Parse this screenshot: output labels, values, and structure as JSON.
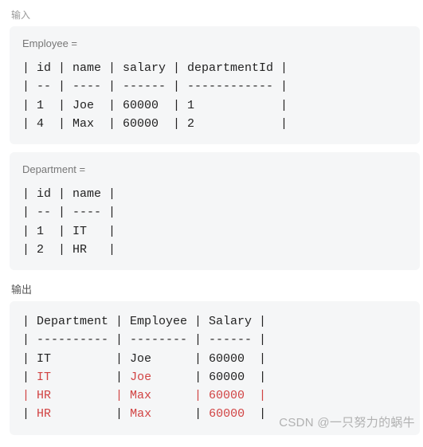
{
  "header_small": "输入",
  "block1": {
    "label": "Employee =",
    "lines": [
      "| id | name | salary | departmentId |",
      "| -- | ---- | ------ | ------------ |",
      "| 1  | Joe  | 60000  | 1            |",
      "| 4  | Max  | 60000  | 2            |"
    ]
  },
  "block2": {
    "label": "Department =",
    "lines": [
      "| id | name |",
      "| -- | ---- |",
      "| 1  | IT   |",
      "| 2  | HR   |"
    ]
  },
  "output_label": "输出",
  "block3": {
    "rows": [
      {
        "text": "| Department | Employee | Salary |",
        "del": false
      },
      {
        "text": "| ---------- | -------- | ------ |",
        "del": false
      },
      {
        "text": "| IT         | Joe      | 60000  |",
        "del": false
      },
      {
        "segments": [
          {
            "t": "| ",
            "d": false
          },
          {
            "t": "IT",
            "d": true
          },
          {
            "t": "         | ",
            "d": false
          },
          {
            "t": "Joe",
            "d": true
          },
          {
            "t": "      | 60000  |",
            "d": false
          }
        ]
      },
      {
        "segments": [
          {
            "t": "| HR         | Max      | 60000  |",
            "d": true
          }
        ]
      },
      {
        "segments": [
          {
            "t": "| ",
            "d": false
          },
          {
            "t": "HR",
            "d": true
          },
          {
            "t": "         | ",
            "d": false
          },
          {
            "t": "Max",
            "d": true
          },
          {
            "t": "      | ",
            "d": false
          },
          {
            "t": "60000",
            "d": true
          },
          {
            "t": "  |",
            "d": false
          }
        ]
      }
    ]
  },
  "watermark": "CSDN @一只努力的蜗牛"
}
